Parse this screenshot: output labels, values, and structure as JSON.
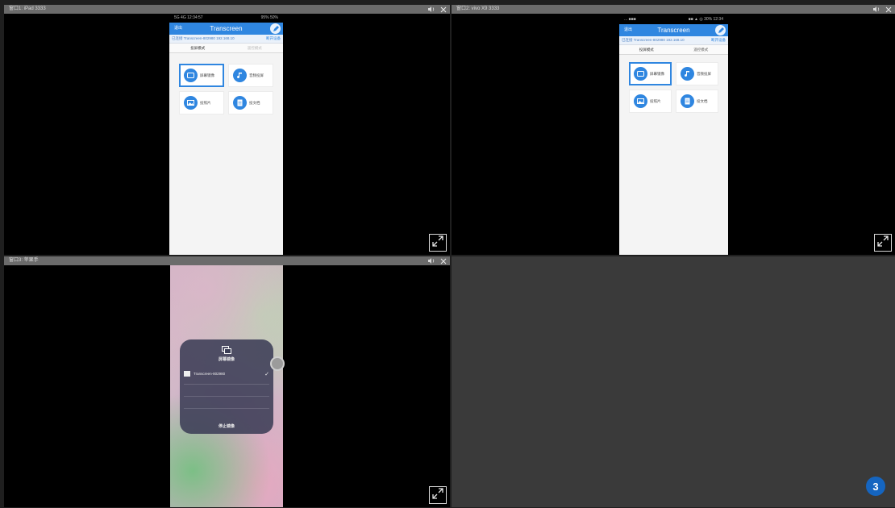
{
  "panes": [
    {
      "title": "窗口1: iPad 3333",
      "phone": {
        "status": {
          "left": "5G 4G 12:34:57",
          "right": "95% 50%"
        },
        "back": "退出",
        "app_title": "Transcreen",
        "connection": "已连接 Transcreen-802980 192.168.10",
        "disconnect": "断开设备",
        "tabs": [
          {
            "label": "投屏模式"
          },
          {
            "label": "遥控模式"
          }
        ],
        "tiles": [
          {
            "label": "屏幕镜像",
            "icon": "screen-icon"
          },
          {
            "label": "音频投屏",
            "icon": "music-icon"
          },
          {
            "label": "投照片",
            "icon": "photo-icon"
          },
          {
            "label": "投文档",
            "icon": "doc-icon"
          }
        ]
      }
    },
    {
      "title": "窗口2: vivo X9 3333",
      "phone": {
        "status": {
          "left": "... ■■■",
          "right": "■■ ▲ ◎ 30% 12:34"
        },
        "back": "退出",
        "app_title": "Transcreen",
        "connection": "已连接 Transcreen-802980 192.168.10",
        "disconnect": "断开设备",
        "tabs": [
          {
            "label": "投屏模式"
          },
          {
            "label": "遥控模式"
          }
        ],
        "tiles": [
          {
            "label": "屏幕镜像",
            "icon": "screen-icon"
          },
          {
            "label": "音频投屏",
            "icon": "music-icon"
          },
          {
            "label": "投照片",
            "icon": "photo-icon"
          },
          {
            "label": "投文档",
            "icon": "doc-icon"
          }
        ]
      }
    },
    {
      "title": "窗口3: 苹果手",
      "mirroring": {
        "title": "屏幕镜像",
        "device": "Transcreen-802980",
        "stop": "停止镜像"
      }
    }
  ],
  "badge": "3"
}
